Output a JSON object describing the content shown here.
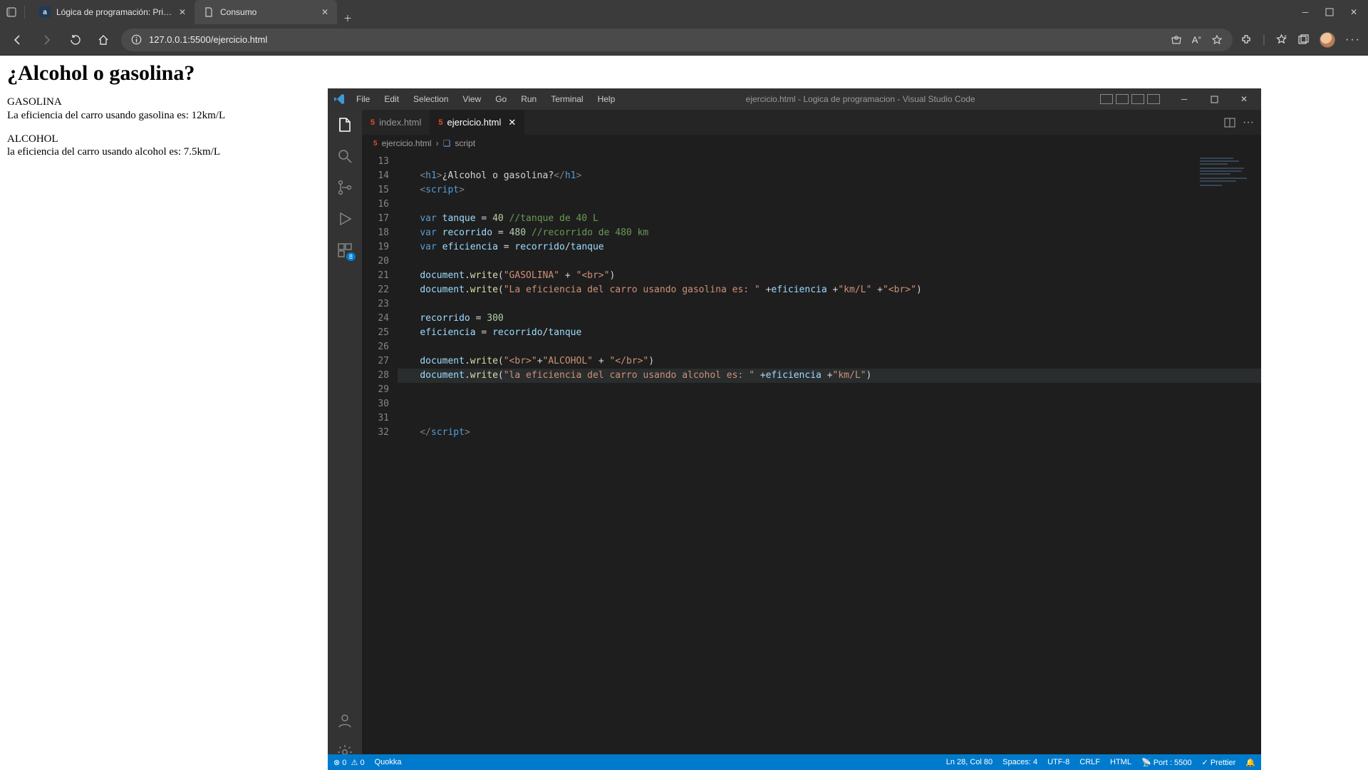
{
  "browser": {
    "tabs": [
      {
        "title": "Lógica de programación: Primer",
        "active": false,
        "icon": "a"
      },
      {
        "title": "Consumo",
        "active": true,
        "icon": "doc"
      }
    ],
    "url": "127.0.0.1:5500/ejercicio.html"
  },
  "page": {
    "heading": "¿Alcohol o gasolina?",
    "gasolina_label": "GASOLINA",
    "gasolina_text": "La eficiencia del carro usando gasolina es: 12km/L",
    "alcohol_label": "ALCOHOL",
    "alcohol_text": "la eficiencia del carro usando alcohol es: 7.5km/L"
  },
  "vscode": {
    "menu": [
      "File",
      "Edit",
      "Selection",
      "View",
      "Go",
      "Run",
      "Terminal",
      "Help"
    ],
    "window_title": "ejercicio.html - Logica de programacion - Visual Studio Code",
    "tabs": [
      {
        "name": "index.html",
        "active": false
      },
      {
        "name": "ejercicio.html",
        "active": true
      }
    ],
    "breadcrumb": {
      "file": "ejercicio.html",
      "symbol": "script"
    },
    "activity_badge": "8",
    "line_numbers": [
      "13",
      "14",
      "15",
      "16",
      "17",
      "18",
      "19",
      "20",
      "21",
      "22",
      "23",
      "24",
      "25",
      "26",
      "27",
      "28",
      "29",
      "30",
      "31",
      "32"
    ],
    "status": {
      "errors": "0",
      "warnings": "0",
      "quokka": "Quokka",
      "ln_col": "Ln 28, Col 80",
      "spaces": "Spaces: 4",
      "enc": "UTF-8",
      "eol": "CRLF",
      "lang": "HTML",
      "port": "Port : 5500",
      "prettier": "Prettier"
    },
    "code_text": {
      "h1_text": "¿Alcohol o gasolina?",
      "tanque_val": "40",
      "tanque_comment": "//tanque de 40 L",
      "recorrido_val": "480",
      "recorrido_comment": "//recorrido de 480 km",
      "gasolina_str": "\"GASOLINA\"",
      "br_str": "\"<br>\"",
      "gasolina_line": "\"La eficiencia del carro usando gasolina es: \"",
      "kmL": "\"km/L\"",
      "recorrido2": "300",
      "br_open": "\"<br>\"",
      "alcohol_str": "\"ALCOHOL\"",
      "br_close": "\"</br>\"",
      "alcohol_line": "\"la eficiencia del carro usando alcohol es: \""
    }
  }
}
